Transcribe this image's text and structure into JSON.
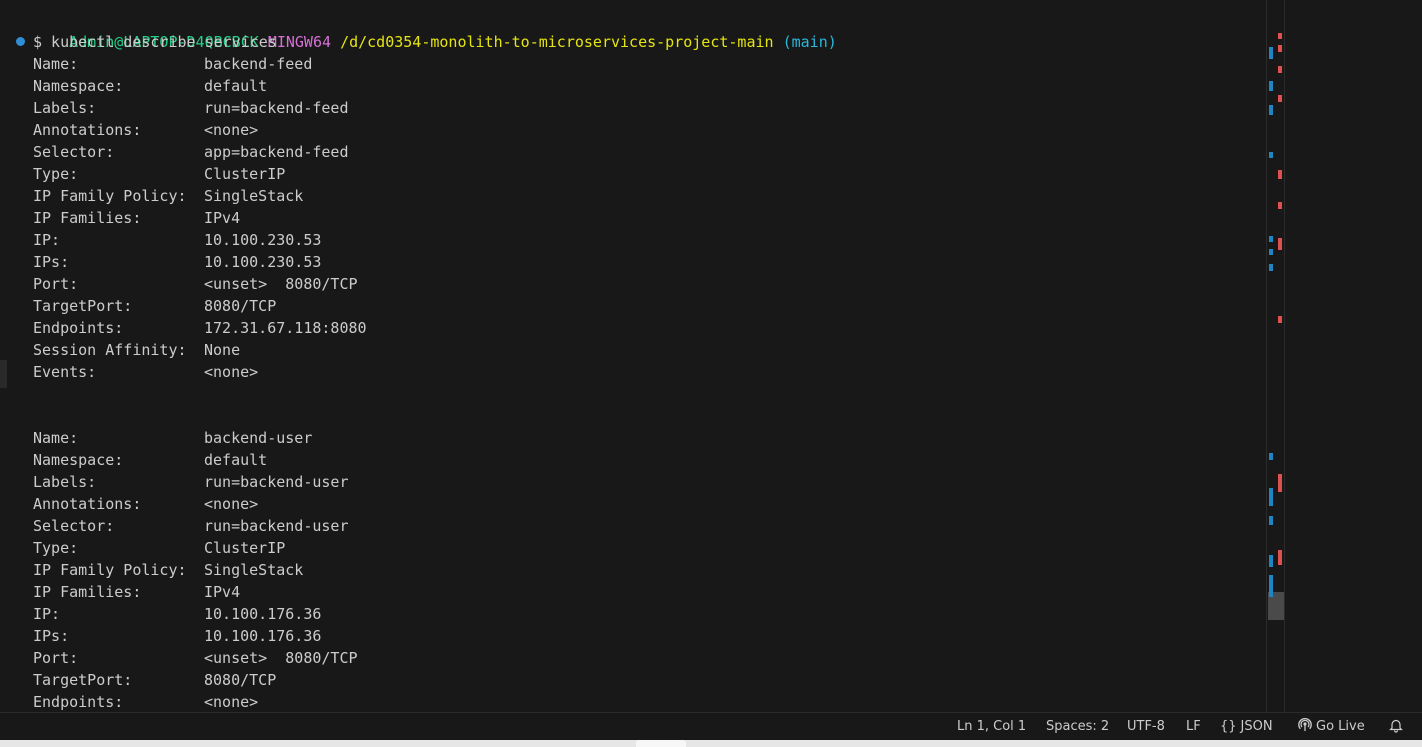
{
  "terminal": {
    "prompt": {
      "user_host": "Admin@LAPTOP-D4QBCBCK",
      "system": "MINGW64",
      "path": "/d/cd0354-monolith-to-microservices-project-main",
      "branch": "(main)"
    },
    "command": "$ kubectl describe services",
    "service1": [
      {
        "key": "Name:",
        "value": "backend-feed"
      },
      {
        "key": "Namespace:",
        "value": "default"
      },
      {
        "key": "Labels:",
        "value": "run=backend-feed"
      },
      {
        "key": "Annotations:",
        "value": "<none>"
      },
      {
        "key": "Selector:",
        "value": "app=backend-feed"
      },
      {
        "key": "Type:",
        "value": "ClusterIP"
      },
      {
        "key": "IP Family Policy:",
        "value": "SingleStack"
      },
      {
        "key": "IP Families:",
        "value": "IPv4"
      },
      {
        "key": "IP:",
        "value": "10.100.230.53"
      },
      {
        "key": "IPs:",
        "value": "10.100.230.53"
      },
      {
        "key": "Port:",
        "value": "<unset>  8080/TCP"
      },
      {
        "key": "TargetPort:",
        "value": "8080/TCP"
      },
      {
        "key": "Endpoints:",
        "value": "172.31.67.118:8080"
      },
      {
        "key": "Session Affinity:",
        "value": "None"
      },
      {
        "key": "Events:",
        "value": "<none>"
      }
    ],
    "service2": [
      {
        "key": "Name:",
        "value": "backend-user"
      },
      {
        "key": "Namespace:",
        "value": "default"
      },
      {
        "key": "Labels:",
        "value": "run=backend-user"
      },
      {
        "key": "Annotations:",
        "value": "<none>"
      },
      {
        "key": "Selector:",
        "value": "run=backend-user"
      },
      {
        "key": "Type:",
        "value": "ClusterIP"
      },
      {
        "key": "IP Family Policy:",
        "value": "SingleStack"
      },
      {
        "key": "IP Families:",
        "value": "IPv4"
      },
      {
        "key": "IP:",
        "value": "10.100.176.36"
      },
      {
        "key": "IPs:",
        "value": "10.100.176.36"
      },
      {
        "key": "Port:",
        "value": "<unset>  8080/TCP"
      },
      {
        "key": "TargetPort:",
        "value": "8080/TCP"
      },
      {
        "key": "Endpoints:",
        "value": "<none>"
      }
    ]
  },
  "statusbar": {
    "position": "Ln 1, Col 1",
    "spaces": "Spaces: 2",
    "encoding": "UTF-8",
    "eol": "LF",
    "language": "JSON",
    "language_icon": "braces-icon",
    "go_live": "Go Live",
    "go_live_icon": "broadcast-icon",
    "notifications_icon": "bell-icon"
  },
  "colors": {
    "background": "#181818",
    "text": "#cccccc",
    "user_host": "#23d18b",
    "system": "#d670d6",
    "path": "#e5e510",
    "branch": "#29b8db",
    "marker_blue": "#1f86c3",
    "marker_red": "#e0504f"
  }
}
